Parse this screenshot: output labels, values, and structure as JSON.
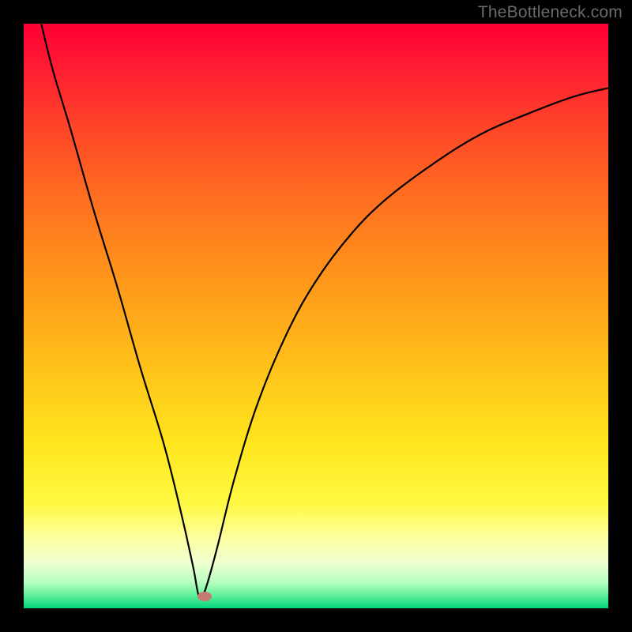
{
  "watermark": "TheBottleneck.com",
  "colors": {
    "frame_bg": "#000000",
    "dot": "#c67a72",
    "curve": "#000000",
    "gradient_stops": [
      {
        "offset": 0.0,
        "color": "#ff0033"
      },
      {
        "offset": 0.07,
        "color": "#ff1a33"
      },
      {
        "offset": 0.18,
        "color": "#ff4628"
      },
      {
        "offset": 0.3,
        "color": "#ff6f20"
      },
      {
        "offset": 0.45,
        "color": "#ff9a1a"
      },
      {
        "offset": 0.6,
        "color": "#ffc51a"
      },
      {
        "offset": 0.72,
        "color": "#ffe61e"
      },
      {
        "offset": 0.82,
        "color": "#fff942"
      },
      {
        "offset": 0.88,
        "color": "#fdffa0"
      },
      {
        "offset": 0.92,
        "color": "#f0ffd0"
      },
      {
        "offset": 0.955,
        "color": "#b8ffc0"
      },
      {
        "offset": 0.978,
        "color": "#60f09a"
      },
      {
        "offset": 1.0,
        "color": "#00d47a"
      }
    ]
  },
  "chart_data": {
    "type": "line",
    "title": "",
    "xlabel": "",
    "ylabel": "",
    "xlim": [
      0,
      100
    ],
    "ylim": [
      0,
      100
    ],
    "minimum_at_x": 30,
    "dot": {
      "x": 31,
      "y": 2
    },
    "series": [
      {
        "name": "bottleneck-curve",
        "x": [
          3,
          5,
          8,
          12,
          16,
          20,
          24,
          27,
          29,
          30,
          31,
          33,
          36,
          40,
          45,
          50,
          56,
          62,
          70,
          78,
          86,
          94,
          100
        ],
        "y": [
          100,
          92,
          82,
          68,
          55,
          41,
          28,
          16,
          7,
          2,
          3,
          10,
          22,
          35,
          47,
          56,
          64,
          70,
          76,
          81,
          84.5,
          87.5,
          89
        ]
      }
    ]
  }
}
